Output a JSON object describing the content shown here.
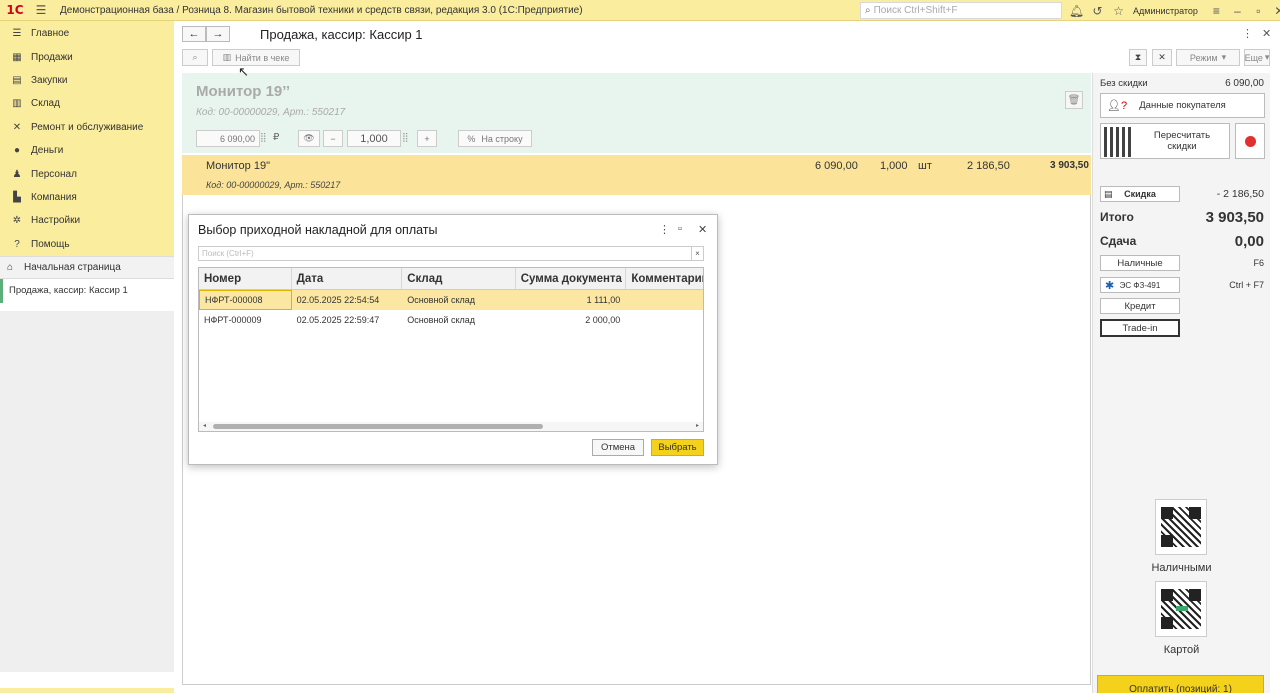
{
  "topbar": {
    "logo": "1С",
    "title": "Демонстрационная база / Розница 8. Магазин бытовой техники и средств связи, редакция 3.0  (1С:Предприятие)",
    "search_placeholder": "Поиск Ctrl+Shift+F",
    "user": "Администратор"
  },
  "sidebar": {
    "items": [
      {
        "label": "Главное",
        "icon": "menu-icon"
      },
      {
        "label": "Продажи",
        "icon": "sales-icon"
      },
      {
        "label": "Закупки",
        "icon": "purchases-icon"
      },
      {
        "label": "Склад",
        "icon": "warehouse-icon"
      },
      {
        "label": "Ремонт и обслуживание",
        "icon": "tools-icon"
      },
      {
        "label": "Деньги",
        "icon": "money-icon"
      },
      {
        "label": "Персонал",
        "icon": "staff-icon"
      },
      {
        "label": "Компания",
        "icon": "company-icon"
      },
      {
        "label": "Настройки",
        "icon": "gear-icon"
      },
      {
        "label": "Помощь",
        "icon": "help-icon"
      }
    ],
    "home": "Начальная страница",
    "open_windows": [
      "Продажа, кассир: Кассир 1"
    ]
  },
  "header": {
    "title": "Продажа, кассир: Кассир 1",
    "find_in_receipt": "Найти в чеке",
    "mode_label": "Режим",
    "more_label": "Еще"
  },
  "product": {
    "name": "Монитор 19’’",
    "code": "Код: 00-00000029, Арт.: 550217",
    "price": "6 090,00",
    "currency": "₽",
    "quantity": "1,000",
    "to_line": "На строку"
  },
  "line": {
    "name": "Монитор 19\"",
    "code": "Код: 00-00000029, Арт.: 550217",
    "price": "6 090,00",
    "qty": "1,000",
    "unit": "шт",
    "discount": "2 186,50",
    "sum": "3 903,50"
  },
  "right_panel": {
    "no_discount_label": "Без скидки",
    "no_discount_value": "6 090,00",
    "customer_data": "Данные покупателя",
    "recalc": "Пересчитать скидки",
    "discount_btn": "Скидка",
    "discount_value": "- 2 186,50",
    "total_label": "Итого",
    "total_value": "3 903,50",
    "change_label": "Сдача",
    "change_value": "0,00",
    "cash_btn": "Наличные",
    "cash_key": "F6",
    "es_btn": "ЭС ФЗ-491",
    "es_key": "Ctrl + F7",
    "credit_btn": "Кредит",
    "tradein_btn": "Trade-in",
    "qr_cash": "Наличными",
    "qr_card": "Картой",
    "pay_btn": "Оплатить (позиций: 1)"
  },
  "dialog": {
    "title": "Выбор приходной накладной для оплаты",
    "search_placeholder": "Поиск (Ctrl+F)",
    "columns": [
      "Номер",
      "Дата",
      "Склад",
      "Сумма документа",
      "Комментарий"
    ],
    "rows": [
      {
        "number": "НФРТ-000008",
        "date": "02.05.2025 22:54:54",
        "warehouse": "Основной склад",
        "sum": "1 111,00",
        "comment": ""
      },
      {
        "number": "НФРТ-000009",
        "date": "02.05.2025 22:59:47",
        "warehouse": "Основной склад",
        "sum": "2 000,00",
        "comment": ""
      }
    ],
    "cancel": "Отмена",
    "select": "Выбрать"
  }
}
